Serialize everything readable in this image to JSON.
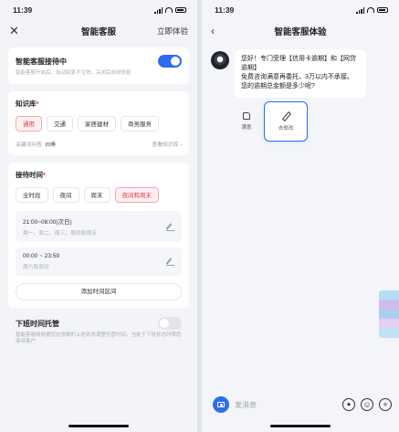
{
  "left": {
    "status": {
      "time": "11:39"
    },
    "nav": {
      "close": "✕",
      "title": "智能客服",
      "action": "立即体验"
    },
    "toggle_card": {
      "title": "智能客服接待中",
      "hint": "智能客服开启后，自动回复不生效，关闭后自动恢复",
      "on": true
    },
    "knowledge": {
      "title": "知识库",
      "required": "*",
      "chips": [
        "通用",
        "交通",
        "家居建材",
        "商务服务"
      ],
      "active_index": 0,
      "count_label": "关键词问答",
      "count_value": "20条",
      "view_link": "查看知识库",
      "view_chevron": "›"
    },
    "reception": {
      "title": "接待时间",
      "required": "*",
      "chips": [
        "全时段",
        "夜间",
        "周末",
        "夜间和周末"
      ],
      "active_index": 3,
      "slots": [
        {
          "time": "21:00~08:00(次日)",
          "days": "周一、周二、周三、周四和周五"
        },
        {
          "time": "00:00 ~ 23:59",
          "days": "周六和周日"
        }
      ],
      "add_button": "添加时间区间"
    },
    "offhours": {
      "title": "下班时间托管",
      "hint": "智能客服将根据您在快聊的上班状态调整托管时间，当处于下班状态时帮您接待客户",
      "on": false
    }
  },
  "right": {
    "status": {
      "time": "11:39"
    },
    "nav": {
      "back": "‹",
      "title": "智能客服体验"
    },
    "message": "您好！专门受理【信用卡逾期】和【网贷逾期】\n免费咨询满意再委托，3万以内不承接。您的逾期总金额是多少呢?",
    "reactions": [
      {
        "label": "满意",
        "icon": "thumbs-up-icon"
      },
      {
        "label": "去修改",
        "icon": "pencil-icon"
      }
    ],
    "input": {
      "placeholder": "发消息"
    },
    "icons": {
      "voice": "⏺",
      "emoji": "☺",
      "plus": "+"
    }
  },
  "colors": {
    "accent": "#2f6bf0",
    "active_chip_text": "#e03a45",
    "active_chip_bg": "#fff1f2"
  }
}
